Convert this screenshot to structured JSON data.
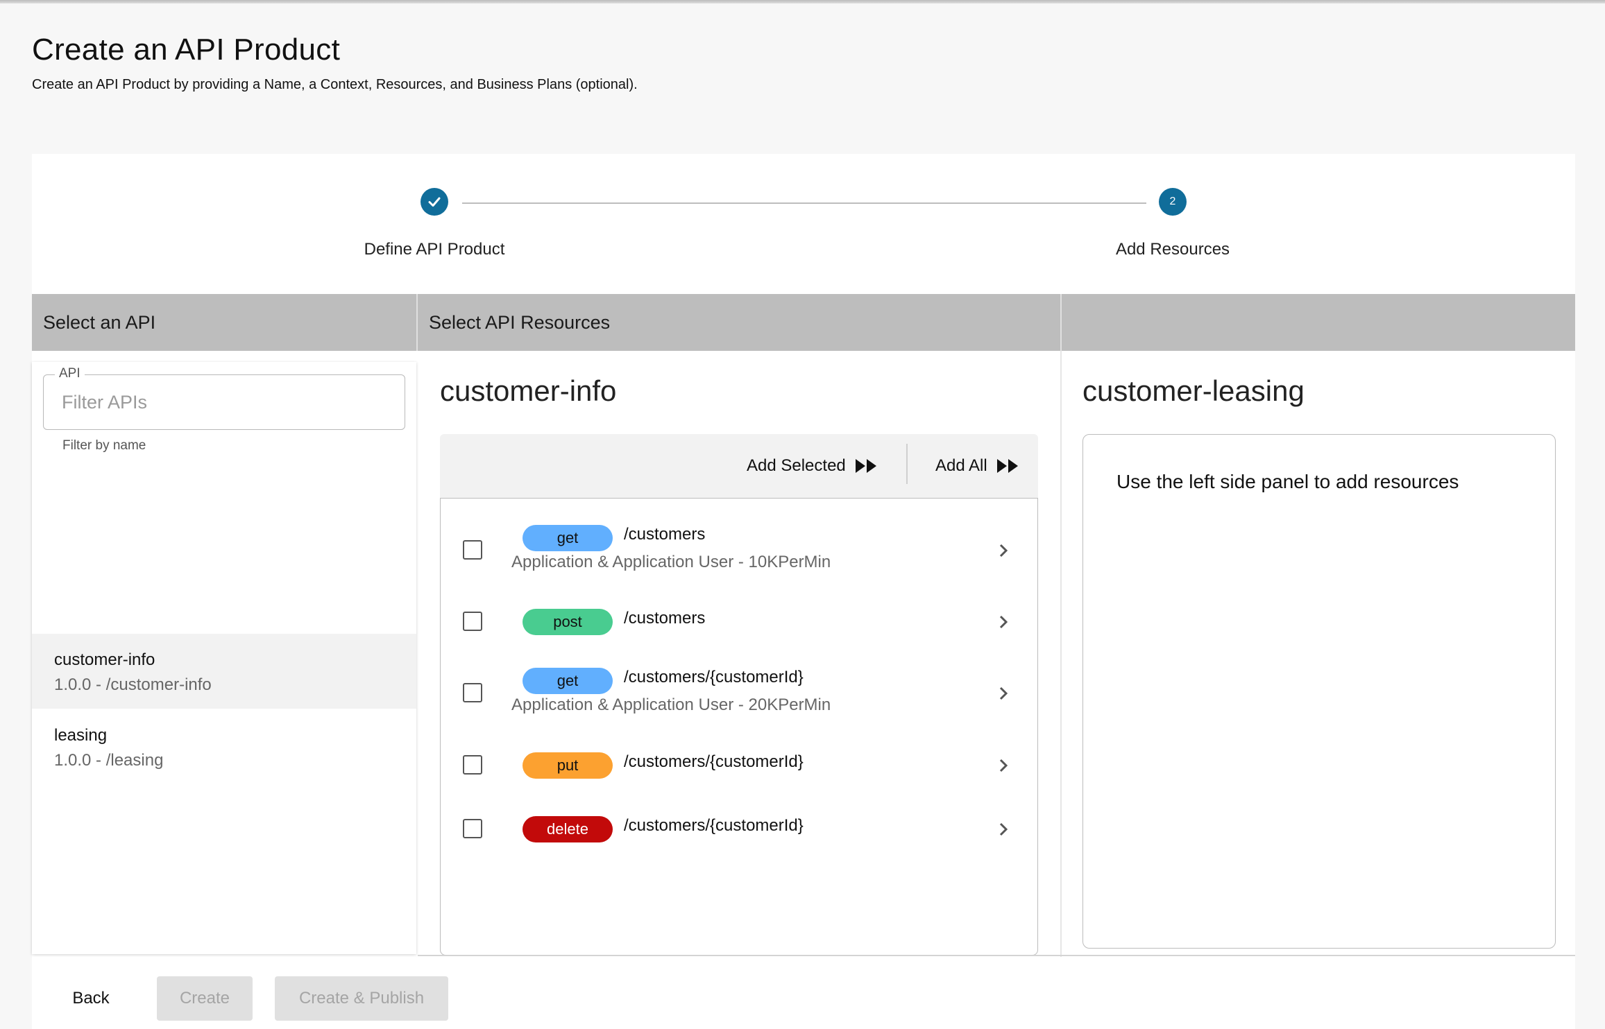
{
  "page": {
    "title": "Create an API Product",
    "subtitle": "Create an API Product by providing a Name, a Context, Resources, and Business Plans (optional)."
  },
  "stepper": {
    "steps": [
      {
        "label": "Define API Product",
        "state": "completed",
        "icon": "check-icon"
      },
      {
        "label": "Add Resources",
        "state": "active",
        "number": "2"
      }
    ]
  },
  "columns": {
    "select_api": "Select an API",
    "select_resources": "Select API Resources",
    "third": ""
  },
  "api_filter": {
    "label": "API",
    "placeholder": "Filter APIs",
    "value": "",
    "helper": "Filter by name"
  },
  "apis": [
    {
      "name": "customer-info",
      "meta": "1.0.0 - /customer-info",
      "selected": true
    },
    {
      "name": "leasing",
      "meta": "1.0.0 - /leasing",
      "selected": false
    }
  ],
  "resources_panel": {
    "title": "customer-info",
    "add_selected_label": "Add Selected",
    "add_all_label": "Add All",
    "resources": [
      {
        "verb": "get",
        "path": "/customers",
        "policy": "Application & Application User - 10KPerMin"
      },
      {
        "verb": "post",
        "path": "/customers",
        "policy": ""
      },
      {
        "verb": "get",
        "path": "/customers/{customerId}",
        "policy": "Application & Application User - 20KPerMin"
      },
      {
        "verb": "put",
        "path": "/customers/{customerId}",
        "policy": ""
      },
      {
        "verb": "delete",
        "path": "/customers/{customerId}",
        "policy": ""
      }
    ]
  },
  "product_panel": {
    "title": "customer-leasing",
    "empty_message": "Use the left side panel to add resources"
  },
  "footer": {
    "back_label": "Back",
    "create_label": "Create",
    "publish_label": "Create & Publish"
  },
  "colors": {
    "primary": "#106d9a",
    "verb_get": "#61affe",
    "verb_post": "#49cc90",
    "verb_put": "#fca130",
    "verb_delete": "#c20a0a",
    "header_bar": "#bdbdbd"
  }
}
